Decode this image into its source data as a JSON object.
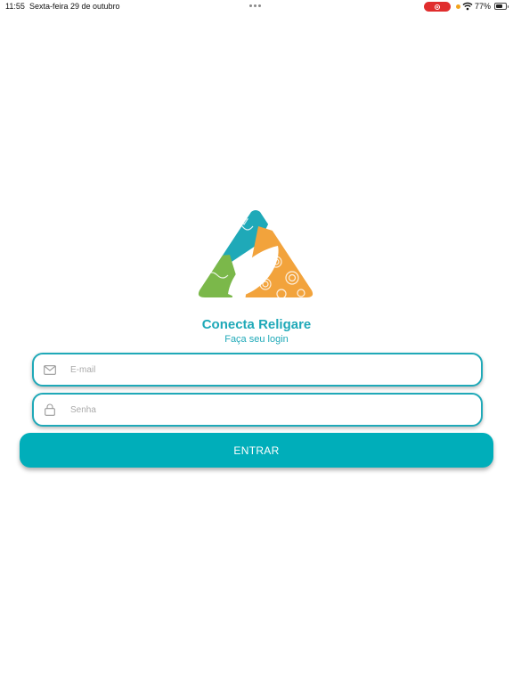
{
  "status_bar": {
    "time": "11:55",
    "date": "Sexta-feira 29 de outubro",
    "battery": "77%",
    "battery_level": 0.77,
    "icons": [
      "dots-icon",
      "screen-record-icon",
      "orange-dot-icon",
      "wifi-icon",
      "battery-icon"
    ]
  },
  "app": {
    "title": "Conecta Religare",
    "subtitle": "Faça seu login",
    "logo": "logo-triangle-icon"
  },
  "form": {
    "email_placeholder": "E-mail",
    "email_value": "",
    "email_icon": "envelope-icon",
    "password_placeholder": "Senha",
    "password_value": "",
    "password_icon": "lock-icon",
    "submit_label": "ENTRAR"
  },
  "colors": {
    "accent": "#1fa9b8",
    "button": "#00aeba",
    "logo_teal": "#1fa9b8",
    "logo_green": "#7bb84a",
    "logo_orange": "#f2a33c",
    "record_red": "#e02d2d"
  }
}
